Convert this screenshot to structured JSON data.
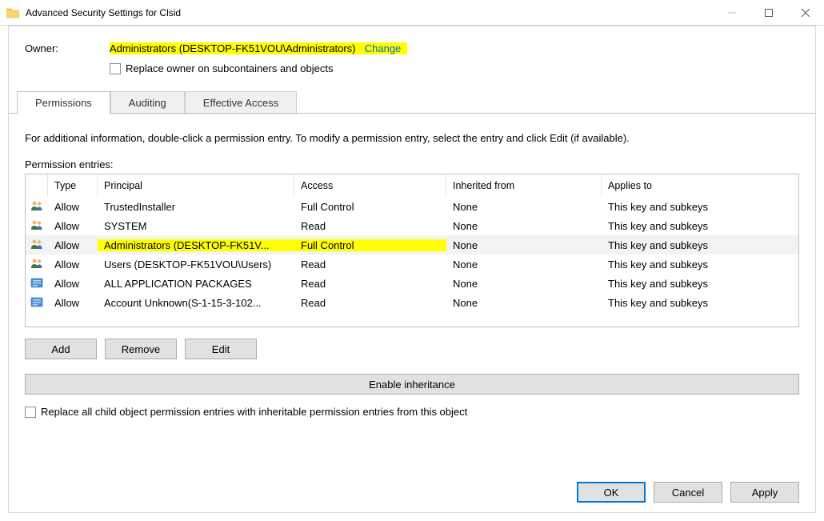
{
  "window": {
    "title": "Advanced Security Settings for Clsid"
  },
  "owner": {
    "label": "Owner:",
    "value": "Administrators (DESKTOP-FK51VOU\\Administrators)",
    "change": "Change",
    "replace_label": "Replace owner on subcontainers and objects"
  },
  "tabs": {
    "permissions": "Permissions",
    "auditing": "Auditing",
    "effective": "Effective Access"
  },
  "body": {
    "info": "For additional information, double-click a permission entry. To modify a permission entry, select the entry and click Edit (if available).",
    "entries_label": "Permission entries:",
    "columns": {
      "type": "Type",
      "principal": "Principal",
      "access": "Access",
      "inherited": "Inherited from",
      "applies": "Applies to"
    },
    "rows": [
      {
        "icon": "people",
        "type": "Allow",
        "principal": "TrustedInstaller",
        "access": "Full Control",
        "inherited": "None",
        "applies": "This key and subkeys"
      },
      {
        "icon": "people",
        "type": "Allow",
        "principal": "SYSTEM",
        "access": "Read",
        "inherited": "None",
        "applies": "This key and subkeys"
      },
      {
        "icon": "people",
        "type": "Allow",
        "principal": "Administrators (DESKTOP-FK51V...",
        "access": "Full Control",
        "inherited": "None",
        "applies": "This key and subkeys",
        "selected": true
      },
      {
        "icon": "people",
        "type": "Allow",
        "principal": "Users (DESKTOP-FK51VOU\\Users)",
        "access": "Read",
        "inherited": "None",
        "applies": "This key and subkeys"
      },
      {
        "icon": "package",
        "type": "Allow",
        "principal": "ALL APPLICATION PACKAGES",
        "access": "Read",
        "inherited": "None",
        "applies": "This key and subkeys"
      },
      {
        "icon": "package",
        "type": "Allow",
        "principal": "Account Unknown(S-1-15-3-102...",
        "access": "Read",
        "inherited": "None",
        "applies": "This key and subkeys"
      }
    ]
  },
  "buttons": {
    "add": "Add",
    "remove": "Remove",
    "edit": "Edit",
    "enable_inh": "Enable inheritance",
    "replace_child": "Replace all child object permission entries with inheritable permission entries from this object",
    "ok": "OK",
    "cancel": "Cancel",
    "apply": "Apply"
  }
}
